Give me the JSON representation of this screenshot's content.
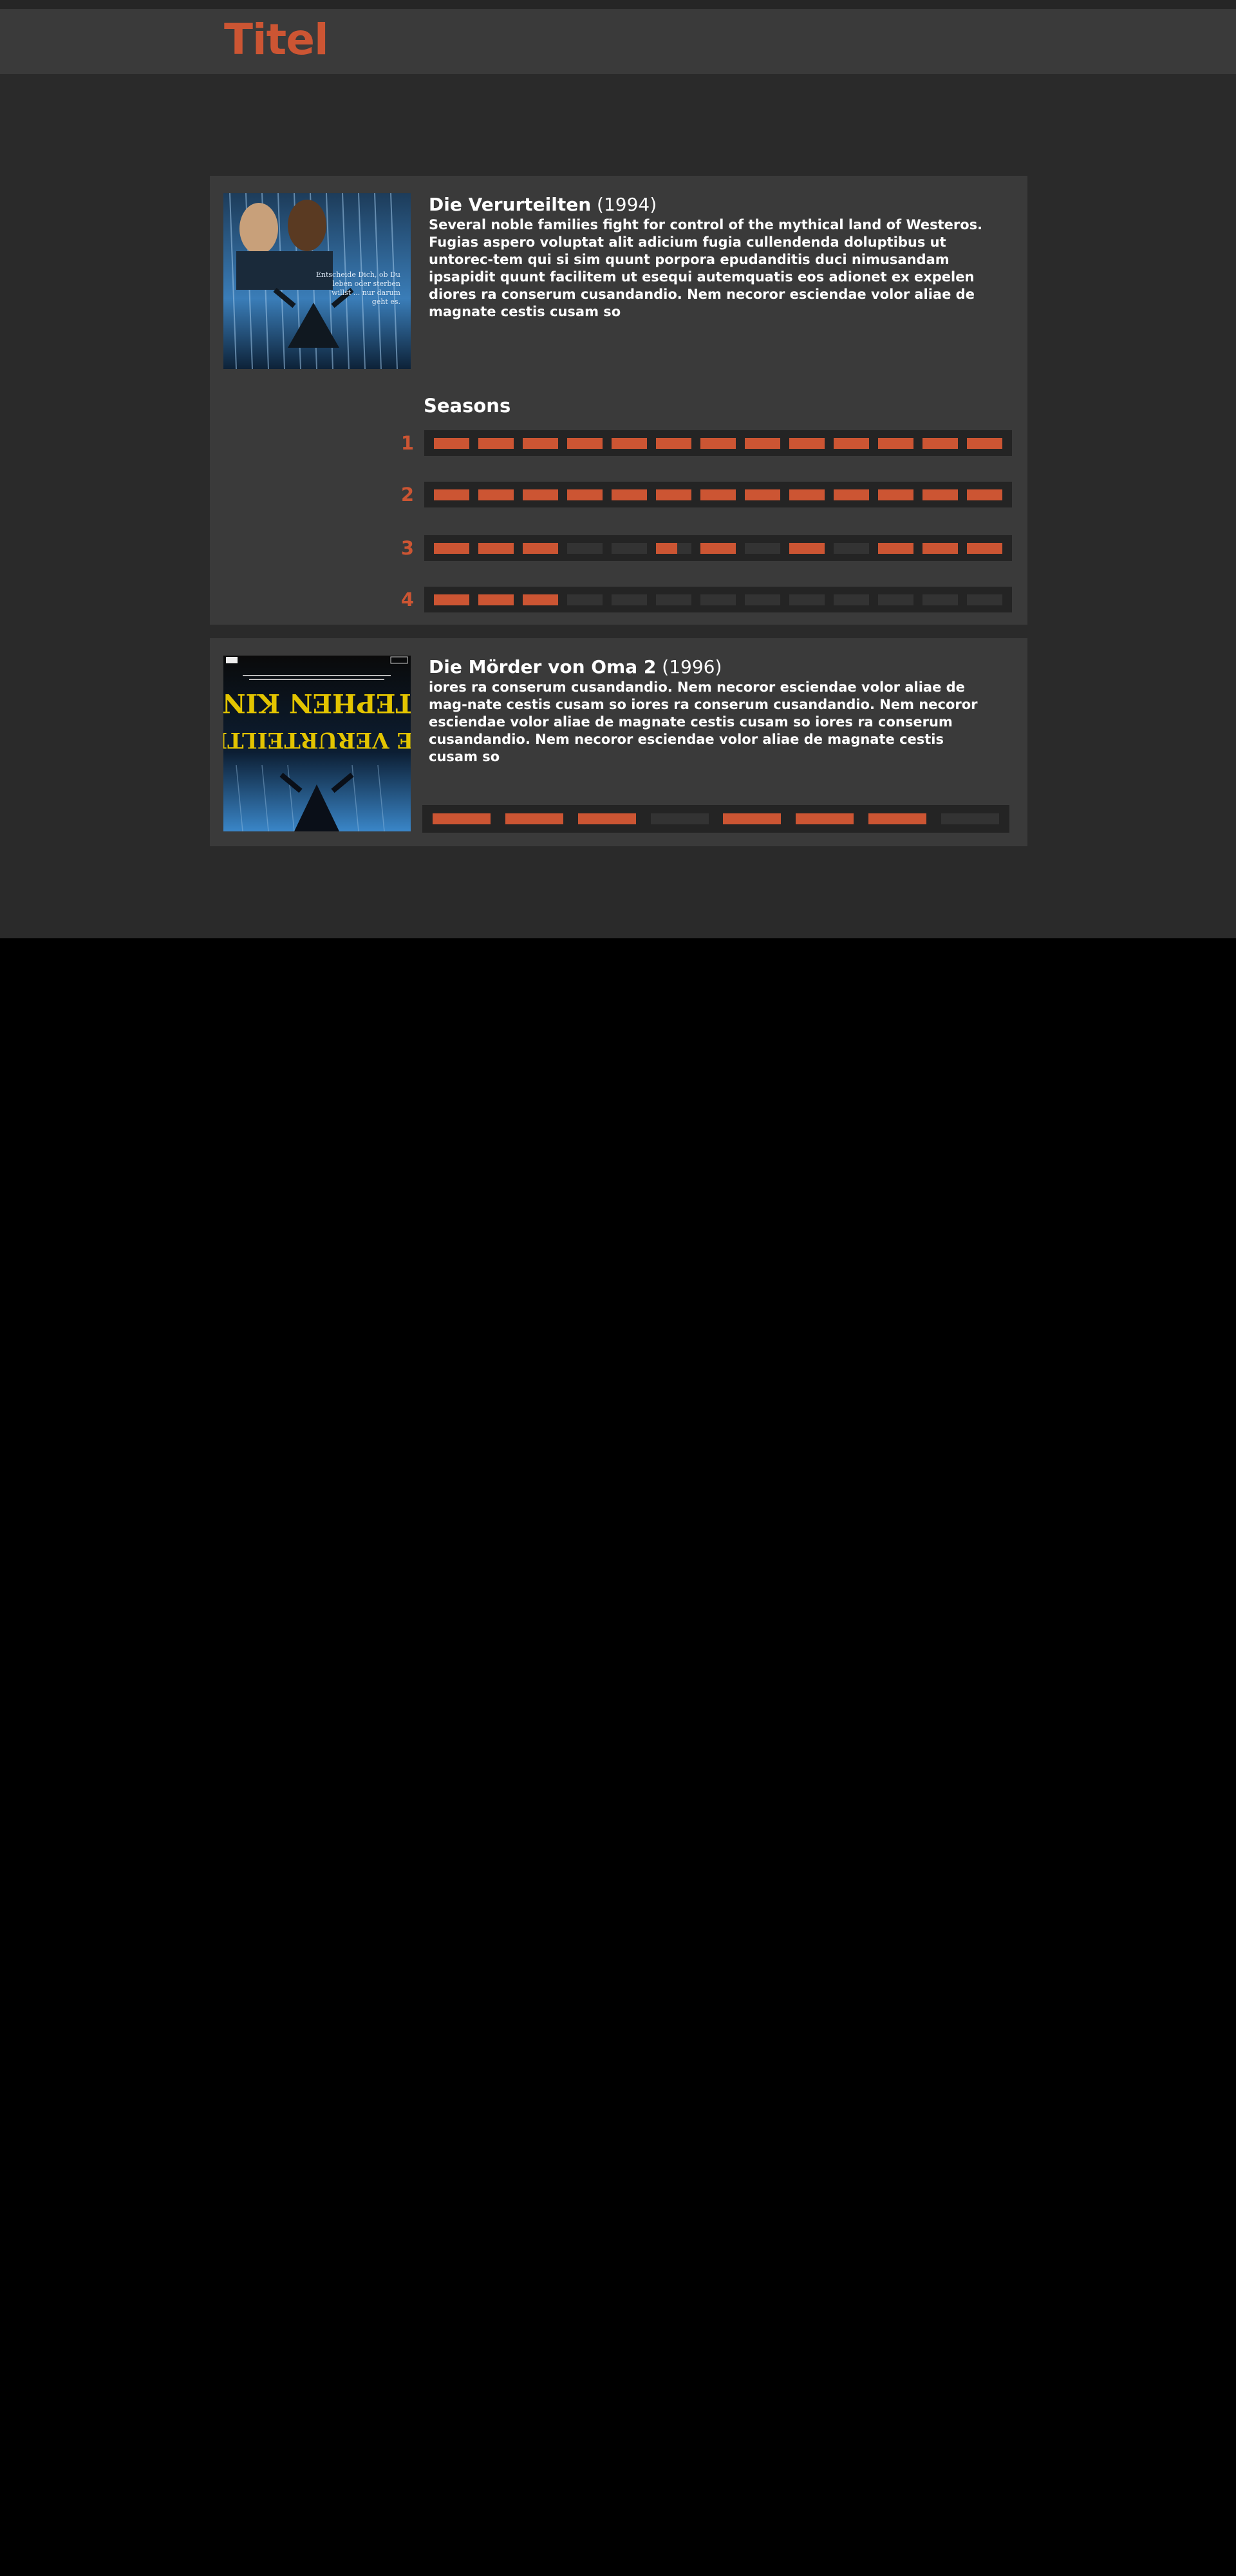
{
  "header": {
    "logo": "Titel"
  },
  "items": [
    {
      "title": "Die Verurteilten",
      "year": "(1994)",
      "poster_tagline": "Entscheide Dich, ob Du leben oder sterben willst ... nur darum geht es.",
      "description": "Several noble families fight for control of the mythical land of Westeros. Fugias aspero voluptat alit adicium fugia cullendenda doluptibus ut untorec-tem qui si sim quunt porpora epudanditis duci nimusandam ipsapidit quunt facilitem ut esequi autemquatis eos adionet ex expelen diores ra conserum cusandandio. Nem necoror esciendae volor aliae de magnate cestis cusam so",
      "seasons_heading": "Seasons",
      "seasons": [
        {
          "label": "1",
          "episodes": [
            1,
            1,
            1,
            1,
            1,
            1,
            1,
            1,
            1,
            1,
            1,
            1,
            1
          ]
        },
        {
          "label": "2",
          "episodes": [
            1,
            1,
            1,
            1,
            1,
            1,
            1,
            1,
            1,
            1,
            1,
            1,
            1
          ]
        },
        {
          "label": "3",
          "episodes": [
            1,
            1,
            1,
            0,
            0,
            0.6,
            1,
            0,
            1,
            0,
            1,
            1,
            1
          ]
        },
        {
          "label": "4",
          "episodes": [
            1,
            1,
            1,
            0,
            0,
            0,
            0,
            0,
            0,
            0,
            0,
            0,
            0
          ]
        }
      ]
    },
    {
      "title": "Die Mörder von Oma 2",
      "year": "(1996)",
      "poster_text": {
        "author": "STEPHEN KING",
        "film": "DIE VERURTEILTEN"
      },
      "description": "iores ra conserum cusandandio. Nem necoror esciendae volor aliae de mag-nate cestis cusam so iores ra conserum cusandandio. Nem necoror esciendae volor aliae de magnate cestis cusam so iores ra conserum cusandandio. Nem necoror esciendae volor aliae de magnate cestis cusam so",
      "episodes": [
        1,
        1,
        1,
        0,
        1,
        1,
        1,
        0
      ]
    }
  ],
  "colors": {
    "accent": "#cc5533",
    "page_bg": "#2a2a2a",
    "card_bg": "#3a3a3a",
    "track_bg": "#242424",
    "unwatched": "#333333"
  }
}
